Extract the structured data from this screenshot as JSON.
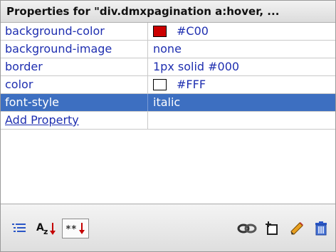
{
  "panel": {
    "title": "Properties for \"div.dmxpagination a:hover, ..."
  },
  "properties": [
    {
      "name": "background-color",
      "value": "#C00",
      "swatch": "#cc0000"
    },
    {
      "name": "background-image",
      "value": "none"
    },
    {
      "name": "border",
      "value": "1px solid #000"
    },
    {
      "name": "color",
      "value": "#FFF",
      "swatch": "#ffffff"
    },
    {
      "name": "font-style",
      "value": "italic",
      "selected": true
    }
  ],
  "add_property_label": "Add Property",
  "toolbar": {
    "left": [
      "category-view-icon",
      "alphabetical-view-icon",
      "set-properties-only-icon"
    ],
    "right": [
      "attach-style-sheet-icon",
      "new-css-rule-icon",
      "edit-style-icon",
      "delete-css-property-icon"
    ],
    "sort_icon_text": "A",
    "sort_icon_sub": "z",
    "set_only_text": "**"
  },
  "colors": {
    "selected_row": "#3d6fc1",
    "property_text": "#1f2fb0"
  }
}
